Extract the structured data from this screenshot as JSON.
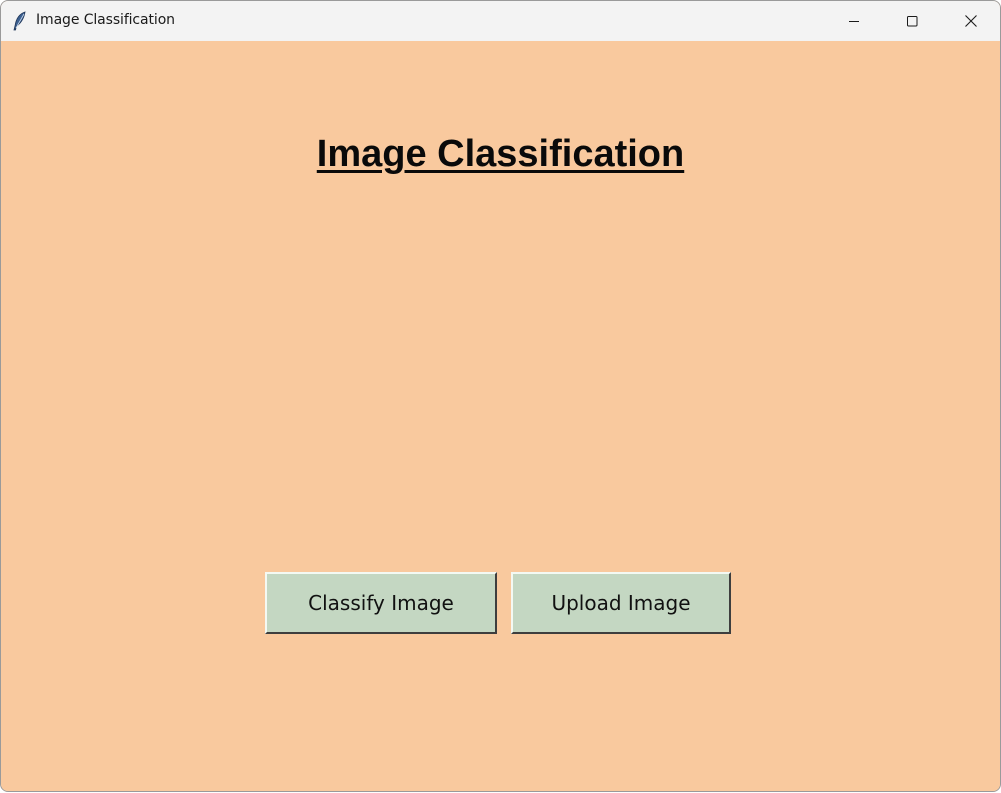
{
  "window": {
    "title": "Image Classification",
    "app_icon": "feather-icon",
    "controls": {
      "minimize": "minimize-icon",
      "maximize": "maximize-icon",
      "close": "close-icon"
    },
    "background_color": "#f9c99e"
  },
  "main": {
    "heading": "Image Classification",
    "buttons": {
      "classify_label": "Classify Image",
      "upload_label": "Upload Image",
      "button_color": "#c4d7c2"
    }
  }
}
